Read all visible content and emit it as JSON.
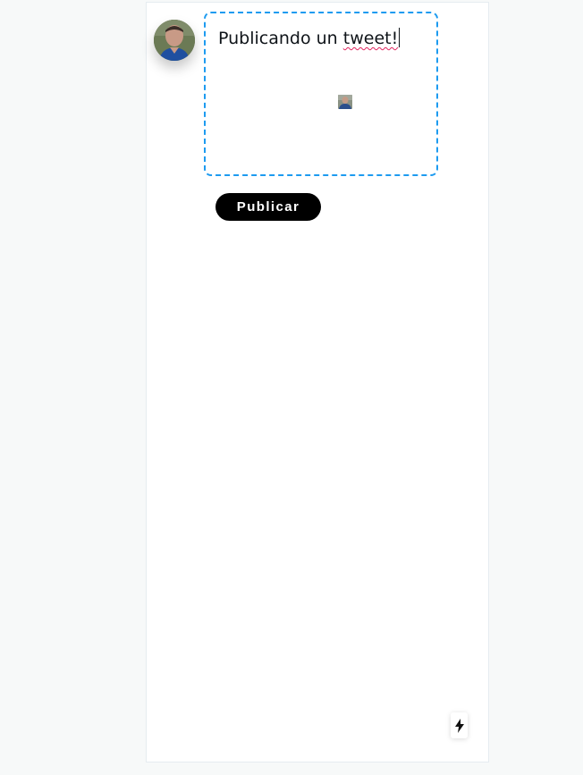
{
  "composer": {
    "text_before": "Publicando un ",
    "text_misspelled": "tweet!",
    "attachment_icon": "image-thumbnail-icon"
  },
  "avatar": {
    "icon": "user-avatar-photo"
  },
  "actions": {
    "publish_label": "Publicar"
  },
  "dev_indicator": {
    "icon": "lightning-bolt-icon"
  },
  "colors": {
    "page_background": "#f7f9f9",
    "card_background": "#ffffff",
    "compose_border": "#1d9bf0",
    "button_background": "#000000",
    "button_text": "#ffffff",
    "spellcheck_underline": "#e0245e"
  }
}
